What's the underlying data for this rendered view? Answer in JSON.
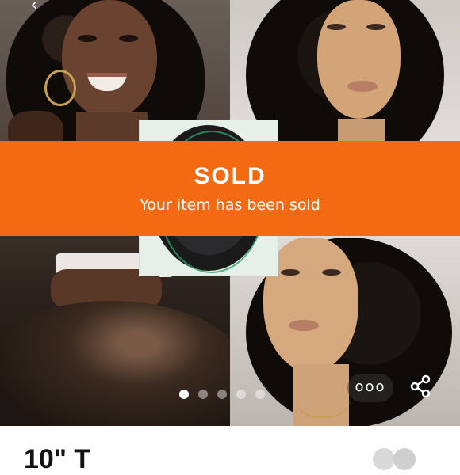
{
  "banner": {
    "status": "SOLD",
    "message": "Your item has been sold",
    "color": "#f46a12"
  },
  "carousel": {
    "total_dots": 5,
    "active_index": 0
  },
  "actions": {
    "more_label": "ooo",
    "back_icon": "back-arrow-icon",
    "share_icon": "share-icon"
  },
  "listing": {
    "title": "10\" T"
  }
}
